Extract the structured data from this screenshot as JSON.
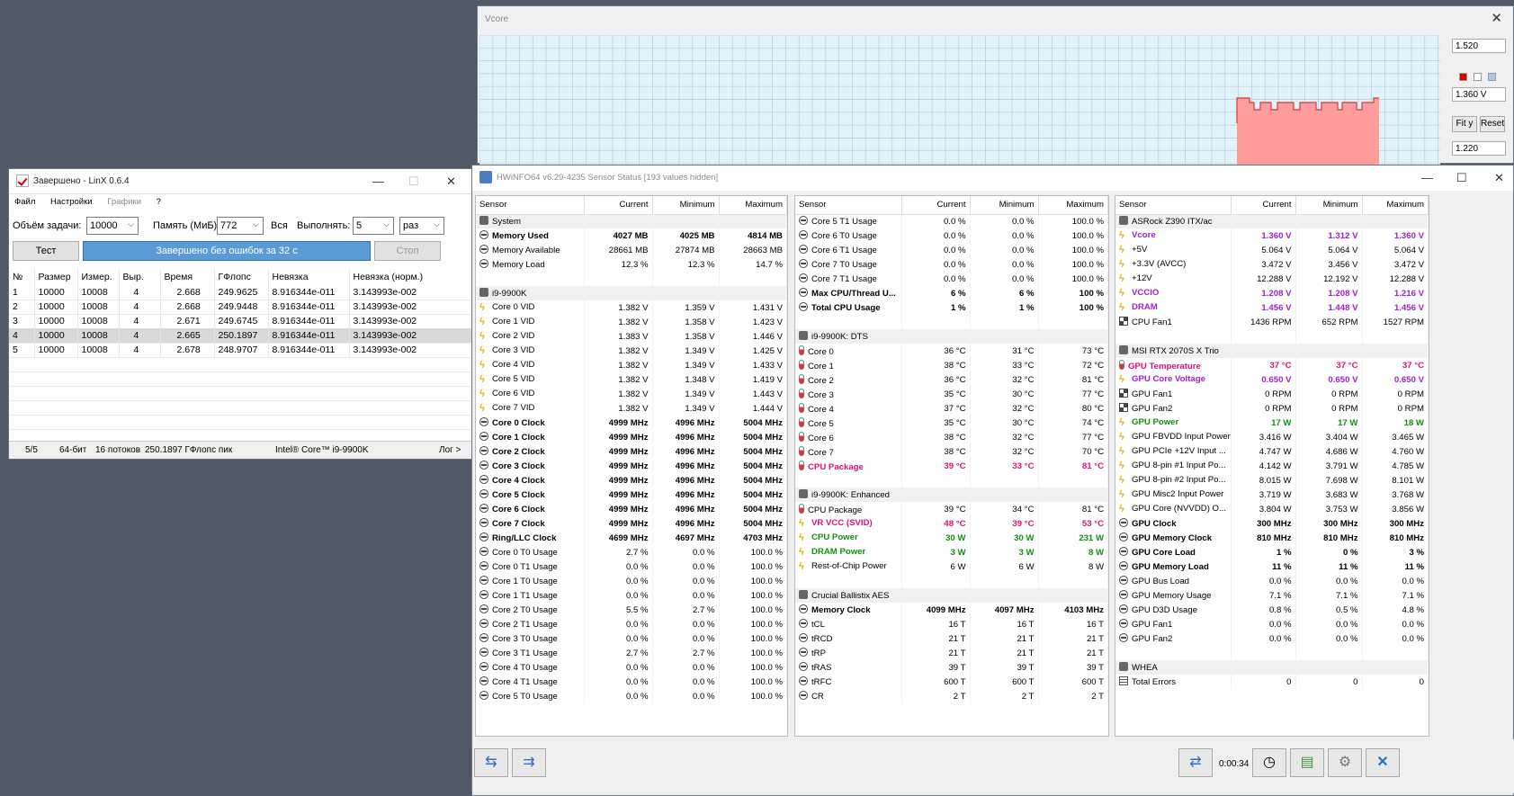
{
  "vcore_window": {
    "title": "Vcore",
    "max": "1.520",
    "current": "1.360 V",
    "min": "1.220",
    "fit_label": "Fit y",
    "reset_label": "Reset",
    "colors": {
      "plot_bg": "#dff3f8",
      "fill": "#ff9c9c",
      "line": "#d83a3a",
      "grid": "#b6cedc"
    }
  },
  "linx": {
    "title": "Завершено - LinX 0.6.4",
    "menu": [
      "Файл",
      "Настройки",
      "Графики",
      "?"
    ],
    "size_label": "Объём задачи:",
    "size_value": "10000",
    "mem_label": "Память (МиБ):",
    "mem_value": "772",
    "all_label": "Вся",
    "run_label": "Выполнять:",
    "run_value": "5",
    "run_unit": "раз",
    "test_btn": "Тест",
    "progress_text": "Завершено без ошибок за 32 с",
    "stop_btn": "Стоп",
    "columns": [
      "№",
      "Размер",
      "Измер.",
      "Выр.",
      "Время",
      "ГФлопс",
      "Невязка",
      "Невязка (норм.)"
    ],
    "rows": [
      [
        "1",
        "10000",
        "10008",
        "4",
        "2.668",
        "249.9625",
        "8.916344e-011",
        "3.143993e-002"
      ],
      [
        "2",
        "10000",
        "10008",
        "4",
        "2.668",
        "249.9448",
        "8.916344e-011",
        "3.143993e-002"
      ],
      [
        "3",
        "10000",
        "10008",
        "4",
        "2.671",
        "249.6745",
        "8.916344e-011",
        "3.143993e-002"
      ],
      [
        "4",
        "10000",
        "10008",
        "4",
        "2.665",
        "250.1897",
        "8.916344e-011",
        "3.143993e-002"
      ],
      [
        "5",
        "10000",
        "10008",
        "4",
        "2.678",
        "248.9707",
        "8.916344e-011",
        "3.143993e-002"
      ]
    ],
    "status": {
      "count": "5/5",
      "bits": "64-бит",
      "threads": "16 потоков",
      "peak": "250.1897 ГФлопс пик",
      "cpu": "Intel® Core™ i9-9900K",
      "log": "Лог >"
    }
  },
  "hwinfo": {
    "title": "HWiNFO64 v6.29-4235 Sensor Status [193 values hidden]",
    "timer": "0:00:34",
    "headers": [
      "Sensor",
      "Current",
      "Minimum",
      "Maximum"
    ],
    "col1": [
      [
        "hdr",
        "gray",
        "System",
        "",
        "",
        ""
      ],
      [
        "b",
        "circ",
        "Memory Used",
        "4027 MB",
        "4025 MB",
        "4814 MB"
      ],
      [
        "",
        "circ",
        "Memory Available",
        "28661 MB",
        "27874 MB",
        "28663 MB"
      ],
      [
        "",
        "circ",
        "Memory Load",
        "12.3 %",
        "12.3 %",
        "14.7 %"
      ],
      [
        "gap",
        "",
        "",
        "",
        "",
        ""
      ],
      [
        "hdr",
        "gray",
        "i9-9900K",
        "",
        "",
        ""
      ],
      [
        "",
        "bolt",
        "Core 0 VID",
        "1.382 V",
        "1.359 V",
        "1.431 V"
      ],
      [
        "",
        "bolt",
        "Core 1 VID",
        "1.382 V",
        "1.358 V",
        "1.423 V"
      ],
      [
        "",
        "bolt",
        "Core 2 VID",
        "1.383 V",
        "1.358 V",
        "1.446 V"
      ],
      [
        "",
        "bolt",
        "Core 3 VID",
        "1.382 V",
        "1.349 V",
        "1.425 V"
      ],
      [
        "",
        "bolt",
        "Core 4 VID",
        "1.382 V",
        "1.349 V",
        "1.433 V"
      ],
      [
        "",
        "bolt",
        "Core 5 VID",
        "1.382 V",
        "1.348 V",
        "1.419 V"
      ],
      [
        "",
        "bolt",
        "Core 6 VID",
        "1.382 V",
        "1.349 V",
        "1.443 V"
      ],
      [
        "",
        "bolt",
        "Core 7 VID",
        "1.382 V",
        "1.349 V",
        "1.444 V"
      ],
      [
        "b",
        "circ",
        "Core 0 Clock",
        "4999 MHz",
        "4996 MHz",
        "5004 MHz"
      ],
      [
        "b",
        "circ",
        "Core 1 Clock",
        "4999 MHz",
        "4996 MHz",
        "5004 MHz"
      ],
      [
        "b",
        "circ",
        "Core 2 Clock",
        "4999 MHz",
        "4996 MHz",
        "5004 MHz"
      ],
      [
        "b",
        "circ",
        "Core 3 Clock",
        "4999 MHz",
        "4996 MHz",
        "5004 MHz"
      ],
      [
        "b",
        "circ",
        "Core 4 Clock",
        "4999 MHz",
        "4996 MHz",
        "5004 MHz"
      ],
      [
        "b",
        "circ",
        "Core 5 Clock",
        "4999 MHz",
        "4996 MHz",
        "5004 MHz"
      ],
      [
        "b",
        "circ",
        "Core 6 Clock",
        "4999 MHz",
        "4996 MHz",
        "5004 MHz"
      ],
      [
        "b",
        "circ",
        "Core 7 Clock",
        "4999 MHz",
        "4996 MHz",
        "5004 MHz"
      ],
      [
        "b",
        "circ",
        "Ring/LLC Clock",
        "4699 MHz",
        "4697 MHz",
        "4703 MHz"
      ],
      [
        "",
        "circ",
        "Core 0 T0 Usage",
        "2.7 %",
        "0.0 %",
        "100.0 %"
      ],
      [
        "",
        "circ",
        "Core 0 T1 Usage",
        "0.0 %",
        "0.0 %",
        "100.0 %"
      ],
      [
        "",
        "circ",
        "Core 1 T0 Usage",
        "0.0 %",
        "0.0 %",
        "100.0 %"
      ],
      [
        "",
        "circ",
        "Core 1 T1 Usage",
        "0.0 %",
        "0.0 %",
        "100.0 %"
      ],
      [
        "",
        "circ",
        "Core 2 T0 Usage",
        "5.5 %",
        "2.7 %",
        "100.0 %"
      ],
      [
        "",
        "circ",
        "Core 2 T1 Usage",
        "0.0 %",
        "0.0 %",
        "100.0 %"
      ],
      [
        "",
        "circ",
        "Core 3 T0 Usage",
        "0.0 %",
        "0.0 %",
        "100.0 %"
      ],
      [
        "",
        "circ",
        "Core 3 T1 Usage",
        "2.7 %",
        "2.7 %",
        "100.0 %"
      ],
      [
        "",
        "circ",
        "Core 4 T0 Usage",
        "0.0 %",
        "0.0 %",
        "100.0 %"
      ],
      [
        "",
        "circ",
        "Core 4 T1 Usage",
        "0.0 %",
        "0.0 %",
        "100.0 %"
      ],
      [
        "",
        "circ",
        "Core 5 T0 Usage",
        "0.0 %",
        "0.0 %",
        "100.0 %"
      ]
    ],
    "col2": [
      [
        "",
        "circ",
        "Core 5 T1 Usage",
        "0.0 %",
        "0.0 %",
        "100.0 %"
      ],
      [
        "",
        "circ",
        "Core 6 T0 Usage",
        "0.0 %",
        "0.0 %",
        "100.0 %"
      ],
      [
        "",
        "circ",
        "Core 6 T1 Usage",
        "0.0 %",
        "0.0 %",
        "100.0 %"
      ],
      [
        "",
        "circ",
        "Core 7 T0 Usage",
        "0.0 %",
        "0.0 %",
        "100.0 %"
      ],
      [
        "",
        "circ",
        "Core 7 T1 Usage",
        "0.0 %",
        "0.0 %",
        "100.0 %"
      ],
      [
        "b",
        "circ",
        "Max CPU/Thread U...",
        "6 %",
        "6 %",
        "100 %"
      ],
      [
        "b",
        "circ",
        "Total CPU Usage",
        "1 %",
        "1 %",
        "100 %"
      ],
      [
        "gap",
        "",
        "",
        "",
        "",
        ""
      ],
      [
        "hdr",
        "gray",
        "i9-9900K: DTS",
        "",
        "",
        ""
      ],
      [
        "",
        "therm",
        "Core 0",
        "36 °C",
        "31 °C",
        "73 °C"
      ],
      [
        "",
        "therm",
        "Core 1",
        "38 °C",
        "33 °C",
        "72 °C"
      ],
      [
        "",
        "therm",
        "Core 2",
        "36 °C",
        "32 °C",
        "81 °C"
      ],
      [
        "",
        "therm",
        "Core 3",
        "35 °C",
        "30 °C",
        "77 °C"
      ],
      [
        "",
        "therm",
        "Core 4",
        "37 °C",
        "32 °C",
        "80 °C"
      ],
      [
        "",
        "therm",
        "Core 5",
        "35 °C",
        "30 °C",
        "74 °C"
      ],
      [
        "",
        "therm",
        "Core 6",
        "38 °C",
        "32 °C",
        "77 °C"
      ],
      [
        "",
        "therm",
        "Core 7",
        "38 °C",
        "32 °C",
        "70 °C"
      ],
      [
        "mag",
        "therm",
        "CPU Package",
        "39 °C",
        "33 °C",
        "81 °C"
      ],
      [
        "gap",
        "",
        "",
        "",
        "",
        ""
      ],
      [
        "hdr",
        "gray",
        "i9-9900K: Enhanced",
        "",
        "",
        ""
      ],
      [
        "",
        "therm",
        "CPU Package",
        "39 °C",
        "34 °C",
        "81 °C"
      ],
      [
        "mag",
        "bolt",
        "VR VCC (SVID)",
        "48 °C",
        "39 °C",
        "53 °C"
      ],
      [
        "grn",
        "bolt",
        "CPU Power",
        "30 W",
        "30 W",
        "231 W"
      ],
      [
        "grn",
        "bolt",
        "DRAM Power",
        "3 W",
        "3 W",
        "8 W"
      ],
      [
        "",
        "bolt",
        "Rest-of-Chip Power",
        "6 W",
        "6 W",
        "8 W"
      ],
      [
        "gap",
        "",
        "",
        "",
        "",
        ""
      ],
      [
        "hdr",
        "gray",
        "Crucial Ballistix AES",
        "",
        "",
        ""
      ],
      [
        "b",
        "circ",
        "Memory Clock",
        "4099 MHz",
        "4097 MHz",
        "4103 MHz"
      ],
      [
        "",
        "circ",
        "tCL",
        "16 T",
        "16 T",
        "16 T"
      ],
      [
        "",
        "circ",
        "tRCD",
        "21 T",
        "21 T",
        "21 T"
      ],
      [
        "",
        "circ",
        "tRP",
        "21 T",
        "21 T",
        "21 T"
      ],
      [
        "",
        "circ",
        "tRAS",
        "39 T",
        "39 T",
        "39 T"
      ],
      [
        "",
        "circ",
        "tRFC",
        "600 T",
        "600 T",
        "600 T"
      ],
      [
        "",
        "circ",
        "CR",
        "2 T",
        "2 T",
        "2 T"
      ]
    ],
    "col3": [
      [
        "hdr",
        "gray",
        "ASRock Z390 ITX/ac",
        "",
        "",
        ""
      ],
      [
        "pur",
        "bolt",
        "Vcore",
        "1.360 V",
        "1.312 V",
        "1.360 V"
      ],
      [
        "",
        "bolt",
        "+5V",
        "5.064 V",
        "5.064 V",
        "5.064 V"
      ],
      [
        "",
        "bolt",
        "+3.3V (AVCC)",
        "3.472 V",
        "3.456 V",
        "3.472 V"
      ],
      [
        "",
        "bolt",
        "+12V",
        "12.288 V",
        "12.192 V",
        "12.288 V"
      ],
      [
        "pur",
        "bolt",
        "VCCIO",
        "1.208 V",
        "1.208 V",
        "1.216 V"
      ],
      [
        "pur",
        "bolt",
        "DRAM",
        "1.456 V",
        "1.448 V",
        "1.456 V"
      ],
      [
        "",
        "fan",
        "CPU Fan1",
        "1436 RPM",
        "652 RPM",
        "1527 RPM"
      ],
      [
        "gap",
        "",
        "",
        "",
        "",
        ""
      ],
      [
        "hdr",
        "gray",
        "MSI RTX 2070S X Trio",
        "",
        "",
        ""
      ],
      [
        "mag",
        "therm",
        "GPU Temperature",
        "37 °C",
        "37 °C",
        "37 °C"
      ],
      [
        "pur",
        "bolt",
        "GPU Core Voltage",
        "0.650 V",
        "0.650 V",
        "0.650 V"
      ],
      [
        "",
        "fan",
        "GPU Fan1",
        "0 RPM",
        "0 RPM",
        "0 RPM"
      ],
      [
        "",
        "fan",
        "GPU Fan2",
        "0 RPM",
        "0 RPM",
        "0 RPM"
      ],
      [
        "grn",
        "bolt",
        "GPU Power",
        "17 W",
        "17 W",
        "18 W"
      ],
      [
        "",
        "bolt",
        "GPU FBVDD Input Power",
        "3.416 W",
        "3.404 W",
        "3.465 W"
      ],
      [
        "",
        "bolt",
        "GPU PCIe +12V Input ...",
        "4.747 W",
        "4.686 W",
        "4.760 W"
      ],
      [
        "",
        "bolt",
        "GPU 8-pin #1 Input Po...",
        "4.142 W",
        "3.791 W",
        "4.785 W"
      ],
      [
        "",
        "bolt",
        "GPU 8-pin #2 Input Po...",
        "8.015 W",
        "7.698 W",
        "8.101 W"
      ],
      [
        "",
        "bolt",
        "GPU Misc2 Input Power",
        "3.719 W",
        "3.683 W",
        "3.768 W"
      ],
      [
        "",
        "bolt",
        "GPU Core (NVVDD) O...",
        "3.804 W",
        "3.753 W",
        "3.856 W"
      ],
      [
        "b",
        "circ",
        "GPU Clock",
        "300 MHz",
        "300 MHz",
        "300 MHz"
      ],
      [
        "b",
        "circ",
        "GPU Memory Clock",
        "810 MHz",
        "810 MHz",
        "810 MHz"
      ],
      [
        "b",
        "circ",
        "GPU Core Load",
        "1 %",
        "0 %",
        "3 %"
      ],
      [
        "b",
        "circ",
        "GPU Memory Load",
        "11 %",
        "11 %",
        "11 %"
      ],
      [
        "",
        "circ",
        "GPU Bus Load",
        "0.0 %",
        "0.0 %",
        "0.0 %"
      ],
      [
        "",
        "circ",
        "GPU Memory Usage",
        "7.1 %",
        "7.1 %",
        "7.1 %"
      ],
      [
        "",
        "circ",
        "GPU D3D Usage",
        "0.8 %",
        "0.5 %",
        "4.8 %"
      ],
      [
        "",
        "circ",
        "GPU Fan1",
        "0.0 %",
        "0.0 %",
        "0.0 %"
      ],
      [
        "",
        "circ",
        "GPU Fan2",
        "0.0 %",
        "0.0 %",
        "0.0 %"
      ],
      [
        "gap",
        "",
        "",
        "",
        "",
        ""
      ],
      [
        "hdr",
        "gray",
        "WHEA",
        "",
        "",
        ""
      ],
      [
        "",
        "list",
        "Total Errors",
        "0",
        "0",
        "0"
      ]
    ]
  }
}
